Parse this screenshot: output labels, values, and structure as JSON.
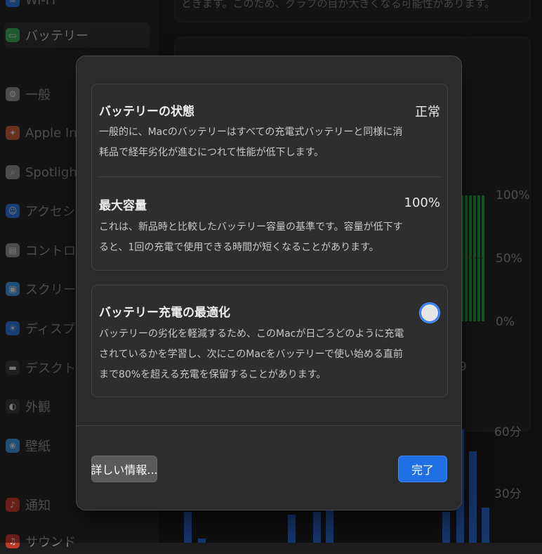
{
  "sidebar": {
    "items": [
      {
        "label": "Wi-Fi",
        "icon": "wifi-icon",
        "color": "#2f6fd6"
      },
      {
        "label": "バッテリー",
        "icon": "battery-icon",
        "color": "#3aa655",
        "selected": true
      },
      {
        "label": "一般",
        "icon": "gear-icon",
        "color": "#8a8a8a"
      },
      {
        "label": "Apple Intelligence",
        "icon": "apple-intelligence-icon",
        "color": "#c05a3a"
      },
      {
        "label": "Spotlight",
        "icon": "search-icon",
        "color": "#8a8a8a"
      },
      {
        "label": "アクセシビリティ",
        "icon": "accessibility-icon",
        "color": "#2f6fd6"
      },
      {
        "label": "コントロールセンター",
        "icon": "control-center-icon",
        "color": "#8a8a8a"
      },
      {
        "label": "スクリーンセーバ",
        "icon": "screensaver-icon",
        "color": "#3b8fd6"
      },
      {
        "label": "ディスプレイ",
        "icon": "display-icon",
        "color": "#2f6fd6"
      },
      {
        "label": "デスクトップとDock",
        "icon": "desktop-dock-icon",
        "color": "#3a3a3a"
      },
      {
        "label": "外観",
        "icon": "appearance-icon",
        "color": "#3a3a3a"
      },
      {
        "label": "壁紙",
        "icon": "wallpaper-icon",
        "color": "#3b8fd6"
      },
      {
        "label": "通知",
        "icon": "notifications-icon",
        "color": "#c0392b"
      },
      {
        "label": "サウンド",
        "icon": "sound-icon",
        "color": "#c0392b"
      }
    ]
  },
  "background": {
    "top_text": "ときます。このため、グラフの目が大きくなる可能性があります。",
    "chart_level_labels": [
      "100%",
      "50%",
      "0%"
    ],
    "chart_x_label": "9",
    "chart_time_labels": [
      "60分",
      "30分"
    ]
  },
  "modal": {
    "battery_health": {
      "title": "バッテリーの状態",
      "value": "正常",
      "description": "一般的に、Macのバッテリーはすべての充電式バッテリーと同様に消耗品で経年劣化が進むにつれて性能が低下します。"
    },
    "max_capacity": {
      "title": "最大容量",
      "value": "100%",
      "description": "これは、新品時と比較したバッテリー容量の基準です。容量が低下すると、1回の充電で使用できる時間が短くなることがあります。"
    },
    "optimized_charging": {
      "title": "バッテリー充電の最適化",
      "enabled": true,
      "description": "バッテリーの劣化を軽減するため、このMacが日ごろどのように充電されているかを学習し、次にこのMacをバッテリーで使い始める直前まで80%を超える充電を保留することがあります。"
    },
    "buttons": {
      "more_info": "詳しい情報...",
      "done": "完了"
    },
    "colors": {
      "accent": "#1f6fe5",
      "toggle_on": "#2f7bf5"
    }
  }
}
